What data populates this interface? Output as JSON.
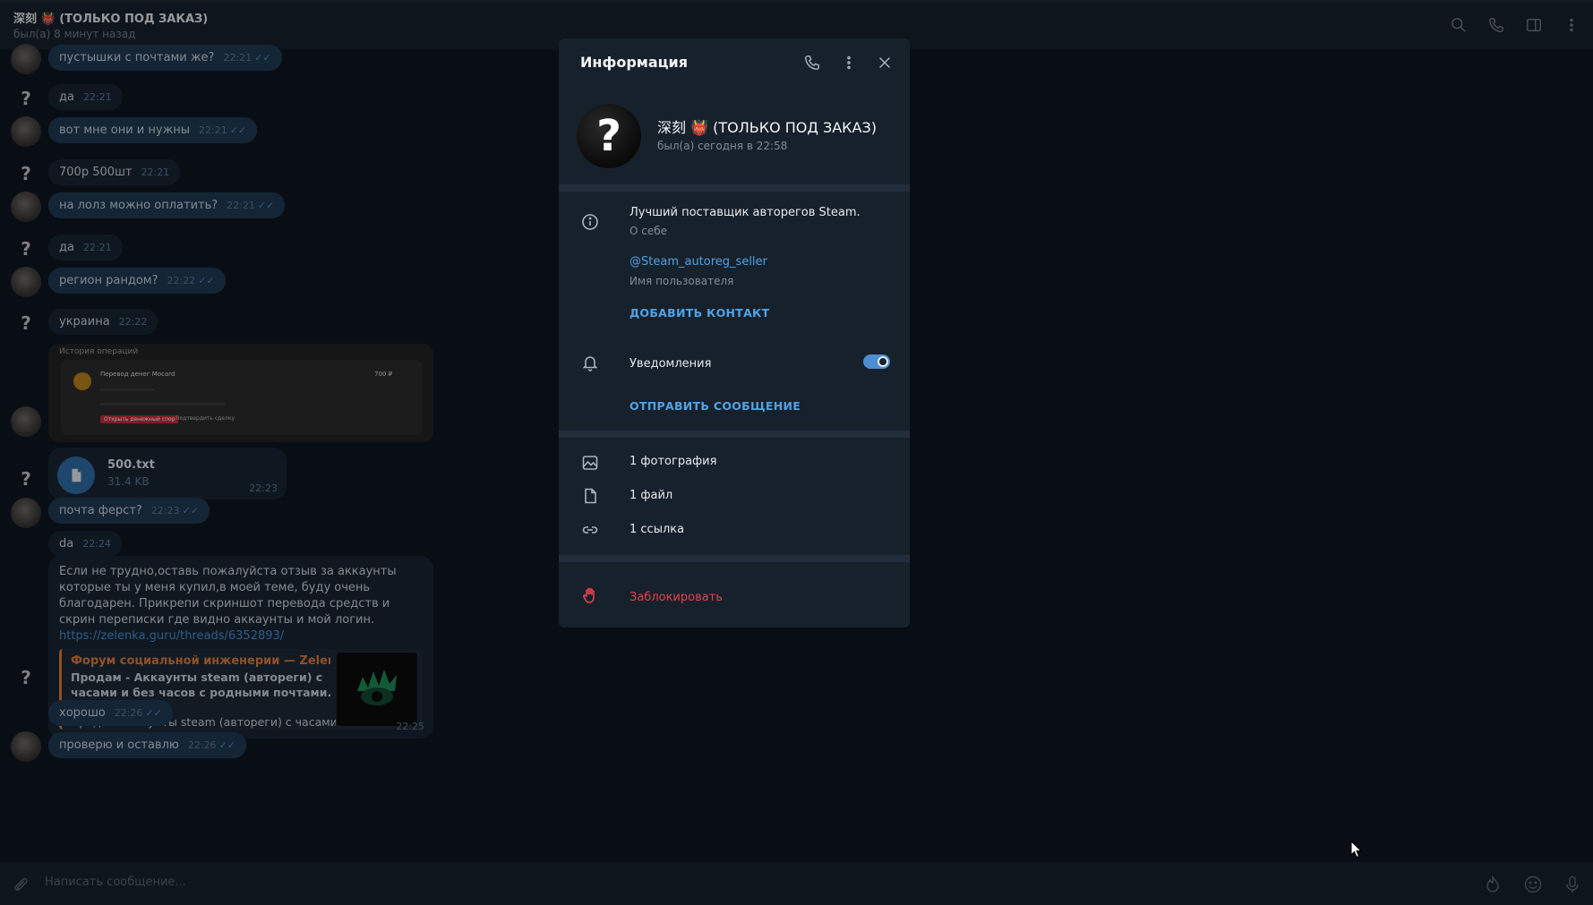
{
  "header": {
    "title": "深刻 👹 (ТОЛЬКО ПОД ЗАКАЗ)",
    "status": "был(а) 8 минут назад",
    "icons": [
      "search-icon",
      "phone-icon",
      "sidebar-icon",
      "more-icon"
    ]
  },
  "messages": [
    {
      "text": "пустышки с почтами же?",
      "time": "22:21",
      "out": true,
      "read": true
    },
    {
      "text": "да",
      "time": "22:21",
      "out": false
    },
    {
      "text": "вот мне они и нужны",
      "time": "22:21",
      "out": true,
      "read": true
    },
    {
      "text": "700р 500шт",
      "time": "22:21",
      "out": false
    },
    {
      "text": "на лолз можно оплатить?",
      "time": "22:21",
      "out": true,
      "read": true
    },
    {
      "text": "да",
      "time": "22:21",
      "out": false
    },
    {
      "text": "регион рандом?",
      "time": "22:22",
      "out": true,
      "read": true
    },
    {
      "text": "украина",
      "time": "22:22",
      "out": false
    },
    {
      "text": "почта ферст?",
      "time": "22:23",
      "out": true,
      "read": true
    },
    {
      "text": "da",
      "time": "22:24",
      "out": false
    },
    {
      "text": "хорошо",
      "time": "22:26",
      "out": true,
      "read": true
    },
    {
      "text": "проверю и оставлю",
      "time": "22:26",
      "out": true,
      "read": true
    }
  ],
  "screenshot_msg": {
    "title": "История операций",
    "line1": "Перевод денег Mocard",
    "amount": "700 ₽",
    "btn_red": "Открыть денежный спор",
    "btn_gray": "Подтвердить сделку"
  },
  "file_msg": {
    "name": "500.txt",
    "size": "31.4 KB",
    "time": "22:23"
  },
  "long_msg": {
    "text": "Если не трудно,оставь пожалуйста отзыв за аккаунты которые ты у меня купил,в моей теме, буду очень благодарен. Прикрепи скриншот перевода средств и скрин переписки где видно аккаунты и мой логин.",
    "link": "https://zelenka.guru/threads/6352893/",
    "preview_title": "Форум социальной инженерии — Zelenka....",
    "preview_desc": "Продам - Аккаунты steam (автореги) с часами и без часов с родными почтами. В...",
    "preview_img": "[IMG]",
    "preview_body": "Продаю  аккаунты steam (автореги) с часами ...",
    "time": "22:25"
  },
  "composer": {
    "placeholder": "Написать сообщение..."
  },
  "info": {
    "title": "Информация",
    "name": "深刻 👹 (ТОЛЬКО ПОД ЗАКАЗ)",
    "last_seen": "был(а) сегодня в 22:58",
    "bio": "Лучший поставщик авторегов Steam.",
    "bio_label": "О себе",
    "username": "@Steam_autoreg_seller",
    "username_label": "Имя пользователя",
    "add_contact": "ДОБАВИТЬ КОНТАКТ",
    "notifications": "Уведомления",
    "notifications_on": true,
    "send_message": "ОТПРАВИТЬ СООБЩЕНИЕ",
    "photos": "1 фотография",
    "files": "1 файл",
    "links": "1 ссылка",
    "block": "Заблокировать"
  },
  "colors": {
    "accent": "#4fa3e6",
    "danger": "#e5424d",
    "bg": "#0e1621",
    "panel": "#17212b"
  }
}
